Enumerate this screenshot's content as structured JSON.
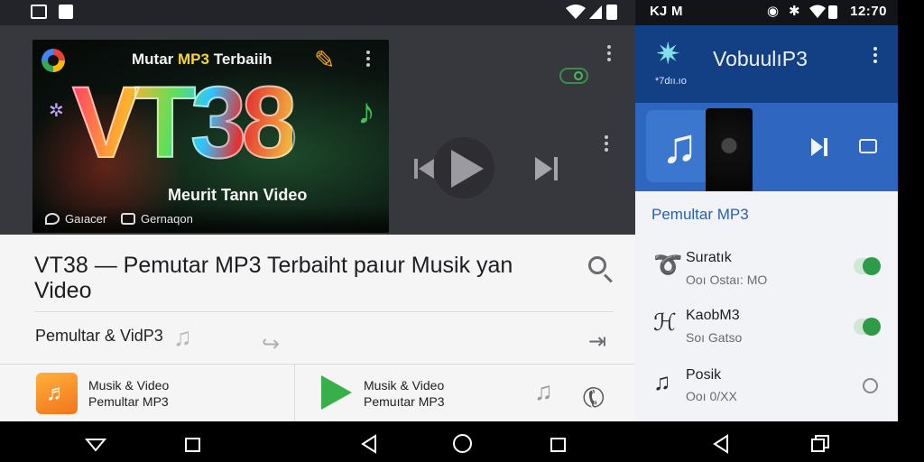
{
  "left_status": {
    "icons": [
      "signal-box-icon",
      "notification-icon",
      "wifi-icon",
      "signal-icon",
      "battery-icon"
    ]
  },
  "thumbnail": {
    "title_part1": "Mutar ",
    "title_highlight": "MP3",
    "title_part2": " Terbaiih",
    "big_text": "VT38",
    "subtitle": "Meurit Tann Video",
    "bottom_left": "Gaıacer",
    "bottom_right": "Gernaqon"
  },
  "video": {
    "title": "VT38 — Pemutar MP3 Terbaiht paıur Musik yan Video",
    "sub_label": "Pemultar & VidP3"
  },
  "apps": [
    {
      "line1": "Musik & Video",
      "line2": "Pemultar MP3"
    },
    {
      "line1": "Musik & Video",
      "line2": "Pemuıtar MP3"
    }
  ],
  "right_status": {
    "time": "12:70",
    "left_glyph": "KJ",
    "left_glyph2": "M"
  },
  "right_header": {
    "title": "VobuulıP3",
    "small": "*7dıı.ıo"
  },
  "right_section": {
    "title": "Pemultar MP3"
  },
  "right_list": [
    {
      "title": "Suratık",
      "sub": "Ooı Ostaı: MO",
      "control": "toggle-on",
      "icon": "loop-icon"
    },
    {
      "title": "KaobM3",
      "sub": "Soı Gatso",
      "control": "toggle-on",
      "icon": "bird-icon"
    },
    {
      "title": "Posik",
      "sub": "Ooı 0/XX",
      "control": "radio-off",
      "icon": "music-note-icon"
    }
  ],
  "colors": {
    "accent_blue": "#133f85",
    "card_blue": "#2f66bf",
    "toggle_green": "#2e9b48",
    "play_green": "#37b04a",
    "app_orange": "#f1751d"
  }
}
